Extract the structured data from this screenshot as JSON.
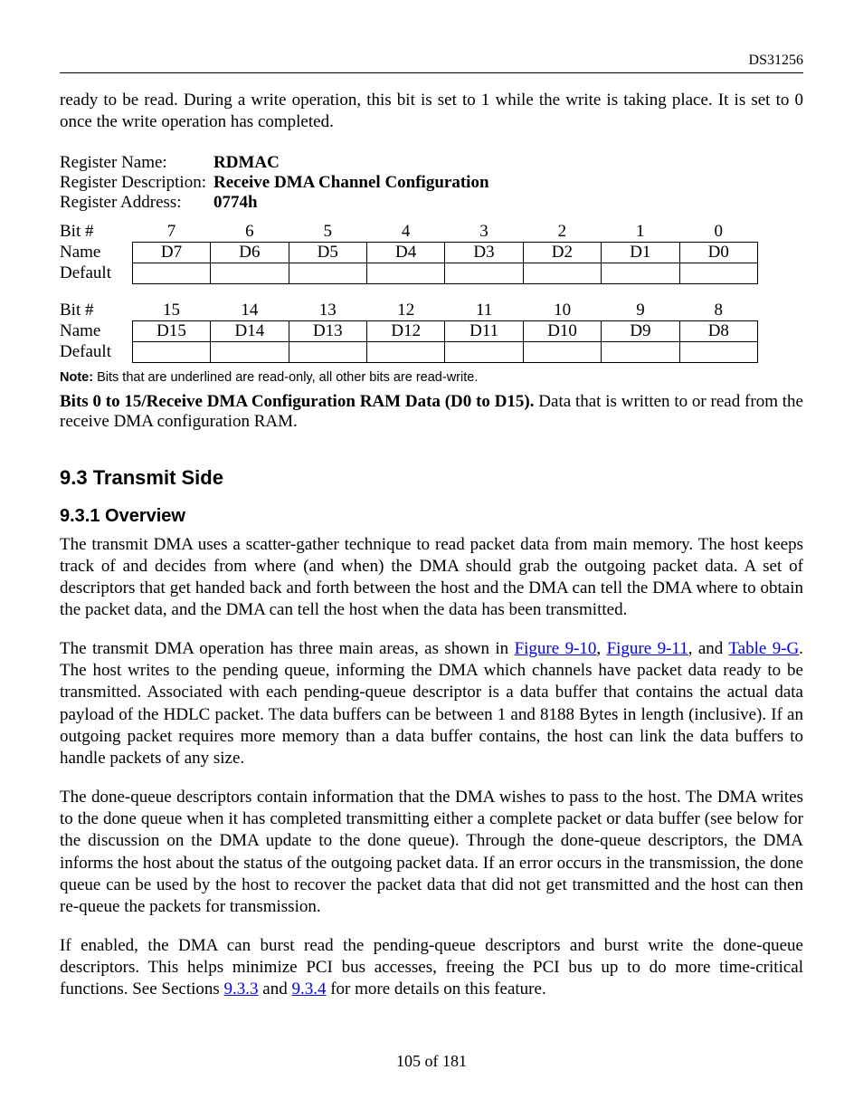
{
  "header": {
    "doc_id": "DS31256"
  },
  "intro_para": "ready to be read. During a write operation, this bit is set to 1 while the write is taking place. It is set to 0 once the write operation has completed.",
  "register": {
    "name_label": "Register Name:",
    "name_value": "RDMAC",
    "desc_label": "Register Description:",
    "desc_value": "Receive DMA Channel Configuration",
    "addr_label": "Register Address:",
    "addr_value": "0774h"
  },
  "tableA": {
    "bit_label": "Bit #",
    "name_label": "Name",
    "default_label": "Default",
    "bits": [
      "7",
      "6",
      "5",
      "4",
      "3",
      "2",
      "1",
      "0"
    ],
    "names": [
      "D7",
      "D6",
      "D5",
      "D4",
      "D3",
      "D2",
      "D1",
      "D0"
    ],
    "defaults": [
      "",
      "",
      "",
      "",
      "",
      "",
      "",
      ""
    ]
  },
  "tableB": {
    "bit_label": "Bit #",
    "name_label": "Name",
    "default_label": "Default",
    "bits": [
      "15",
      "14",
      "13",
      "12",
      "11",
      "10",
      "9",
      "8"
    ],
    "names": [
      "D15",
      "D14",
      "D13",
      "D12",
      "D11",
      "D10",
      "D9",
      "D8"
    ],
    "defaults": [
      "",
      "",
      "",
      "",
      "",
      "",
      "",
      ""
    ]
  },
  "note": {
    "prefix": "Note:",
    "text": " Bits that are underlined are read-only, all other bits are read-write."
  },
  "bits_desc": {
    "bold": "Bits 0 to 15/Receive DMA Configuration RAM Data (D0 to D15).",
    "rest": " Data that is written to or read from the receive DMA configuration RAM."
  },
  "headings": {
    "h2": "9.3  Transmit Side",
    "h3": "9.3.1 Overview"
  },
  "para1": "The transmit DMA uses a scatter-gather technique to read packet data from main memory. The host keeps track of and decides from where (and when) the DMA should grab the outgoing packet data. A set of descriptors that get handed back and forth between the host and the DMA can tell the DMA where to obtain the packet data, and the DMA can tell the host when the data has been transmitted.",
  "para2": {
    "pre": "The transmit DMA operation has three main areas, as shown in ",
    "link1": "Figure 9-10",
    "mid1": ", ",
    "link2": "Figure 9-11",
    "mid2": ", and ",
    "link3": "Table 9-G",
    "post": ". The host writes to the pending queue, informing the DMA which channels have packet data ready to be transmitted. Associated with each pending-queue descriptor is a data buffer that contains the actual data payload of the HDLC packet. The data buffers can be between 1 and 8188 Bytes in length (inclusive). If an outgoing packet requires more memory than a data buffer contains, the host can link the data buffers to handle packets of any size."
  },
  "para3": "The done-queue descriptors contain information that the DMA wishes to pass to the host. The DMA writes to the done queue when it has completed transmitting either a complete packet or data buffer (see below for the discussion on the DMA update to the done queue). Through the done-queue descriptors, the DMA informs the host about the status of the outgoing packet data. If an error occurs in the transmission, the done queue can be used by the host to recover the packet data that did not get transmitted and the host can then re-queue the packets for transmission.",
  "para4": {
    "pre": "If enabled, the DMA can burst read the pending-queue descriptors and burst write the done-queue descriptors. This helps minimize PCI bus accesses, freeing the PCI bus up to do more time-critical functions. See Sections ",
    "link1": "9.3.3",
    "mid": " and ",
    "link2": "9.3.4",
    "post": " for more details on this feature."
  },
  "footer": "105 of 181"
}
